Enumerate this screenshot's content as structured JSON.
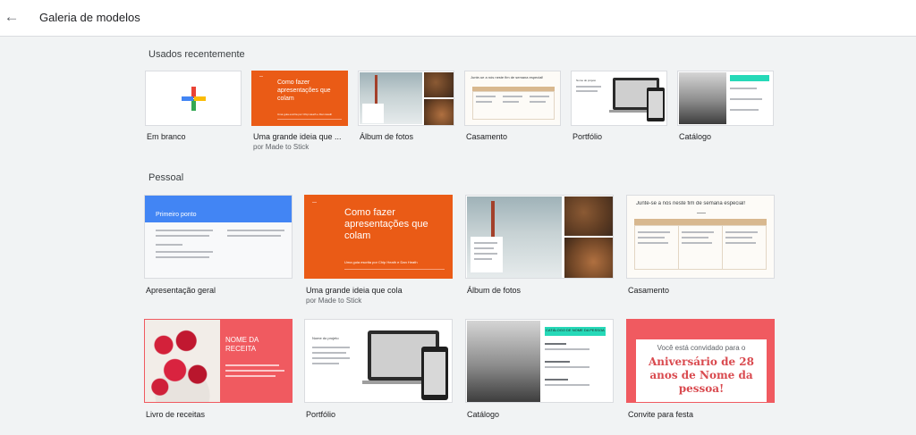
{
  "header": {
    "back_icon": "arrow-back-icon",
    "title": "Galeria de modelos"
  },
  "sections": {
    "recent_title": "Usados recentemente",
    "personal_title": "Pessoal"
  },
  "recent": [
    {
      "name": "Em branco",
      "author": ""
    },
    {
      "name": "Uma grande ideia que ...",
      "author": "por Made to Stick"
    },
    {
      "name": "Álbum de fotos",
      "author": ""
    },
    {
      "name": "Casamento",
      "author": ""
    },
    {
      "name": "Portfólio",
      "author": ""
    },
    {
      "name": "Catálogo",
      "author": ""
    }
  ],
  "personal": [
    {
      "name": "Apresentação geral",
      "author": ""
    },
    {
      "name": "Uma grande ideia que cola",
      "author": "por Made to Stick"
    },
    {
      "name": "Álbum de fotos",
      "author": ""
    },
    {
      "name": "Casamento",
      "author": ""
    },
    {
      "name": "Livro de receitas",
      "author": ""
    },
    {
      "name": "Portfólio",
      "author": ""
    },
    {
      "name": "Catálogo",
      "author": ""
    },
    {
      "name": "Convite para festa",
      "author": ""
    }
  ],
  "thumb_text": {
    "big_idea_small": "Como fazer apresentações que colam",
    "big_idea_large": "Como fazer apresentações que colam",
    "big_idea_subtitle": "Uma guia escrita por Chip Heath e Dan Heath",
    "wedding_heading": "Junte-se a nós neste fim de semana especial!",
    "overview_heading": "Primeiro ponto",
    "recipe_title": "NOME DA RECEITA",
    "catalog_heading": "CATÁLOGO DE NOME DA PESSOA",
    "portfolio_heading": "Nome do projeto",
    "invite_line": "Você está convidado para o",
    "invite_title": "Aniversário de 28 anos de Nome da pessoa!"
  },
  "colors": {
    "accent_blue": "#4285f4",
    "orange": "#ea5b16",
    "coral": "#f05a60",
    "teal": "#26d9b8"
  }
}
